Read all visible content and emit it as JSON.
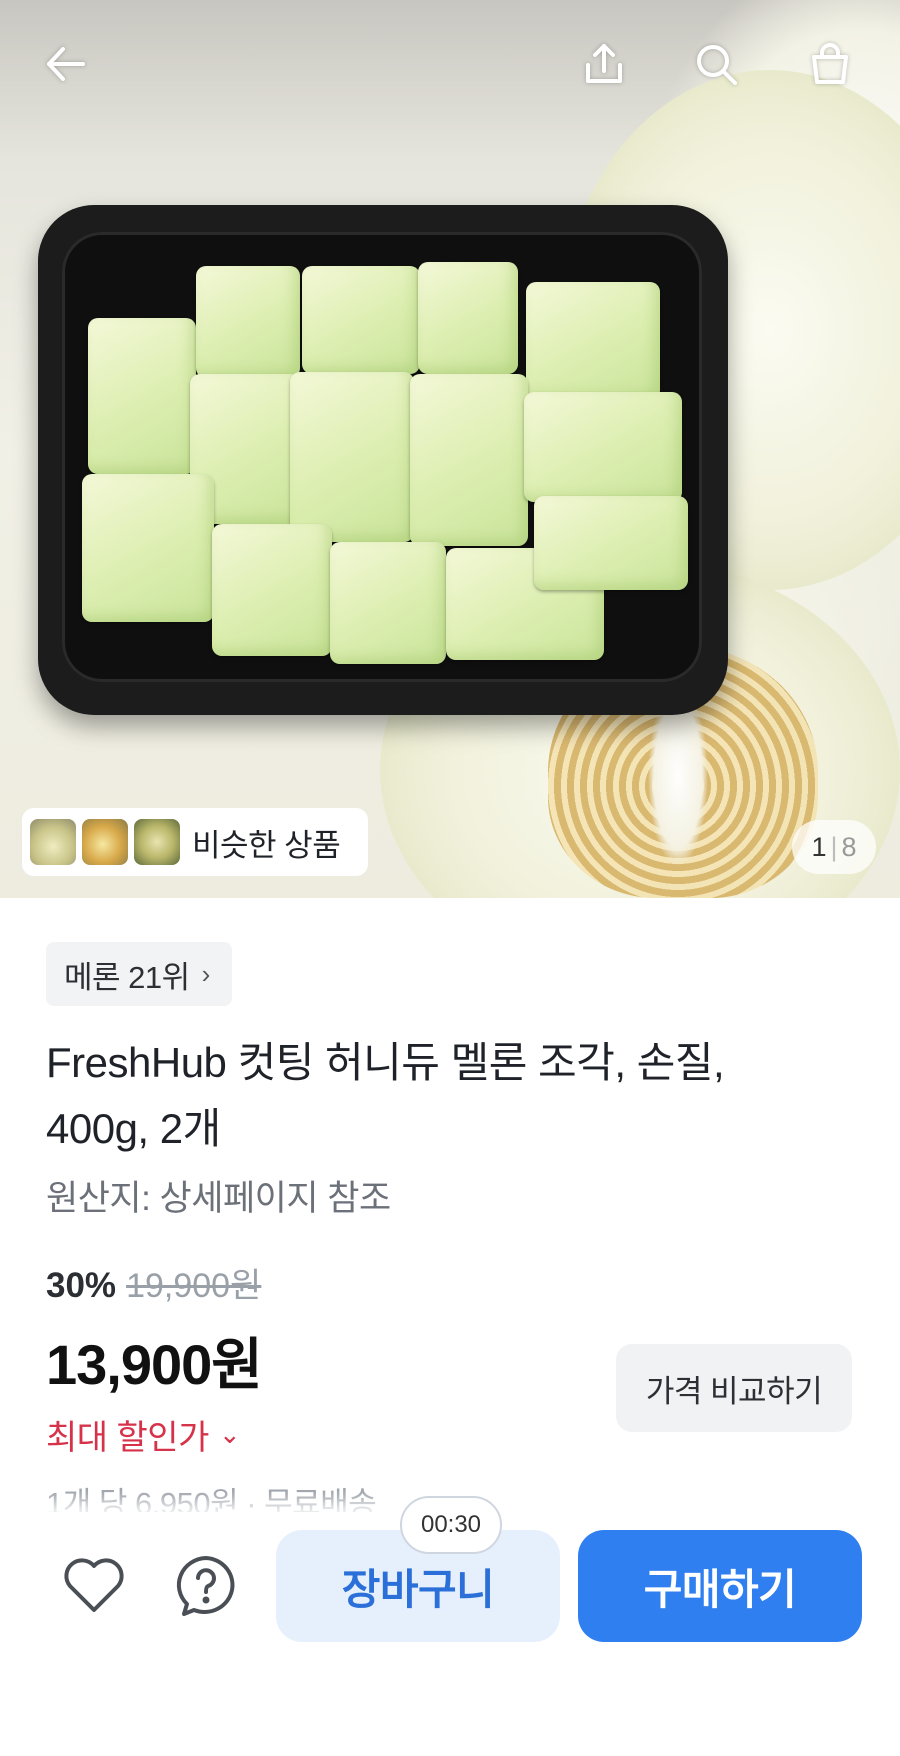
{
  "header": {
    "back_icon": "arrow-left-icon",
    "share_icon": "share-icon",
    "search_icon": "search-icon",
    "cart_icon": "shopping-bag-icon"
  },
  "gallery": {
    "similar_label": "비슷한 상품",
    "current": "1",
    "separator": "|",
    "total": "8"
  },
  "product": {
    "rank_label": "메론 21위",
    "rank_chevron": "›",
    "title_line1": "FreshHub 컷팅 허니듀 멜론 조각, 손질,",
    "title_line2": "400g, 2개",
    "origin": "원산지: 상세페이지 참조",
    "discount": "30%",
    "original_price": "19,900원",
    "price": "13,900원",
    "compare_label": "가격 비교하기",
    "max_discount_label": "최대 할인가",
    "max_discount_chevron": "⌄",
    "unit_price": "1개 당 6,950원 · 무료배송"
  },
  "bottom_bar": {
    "wishlist_icon": "heart-icon",
    "inquiry_icon": "question-bubble-icon",
    "timer": "00:30",
    "cart_label": "장바구니",
    "buy_label": "구매하기"
  },
  "colors": {
    "accent": "#2f7ff0",
    "cart_bg": "#e6f0fd",
    "discount_red": "#d6334a"
  }
}
